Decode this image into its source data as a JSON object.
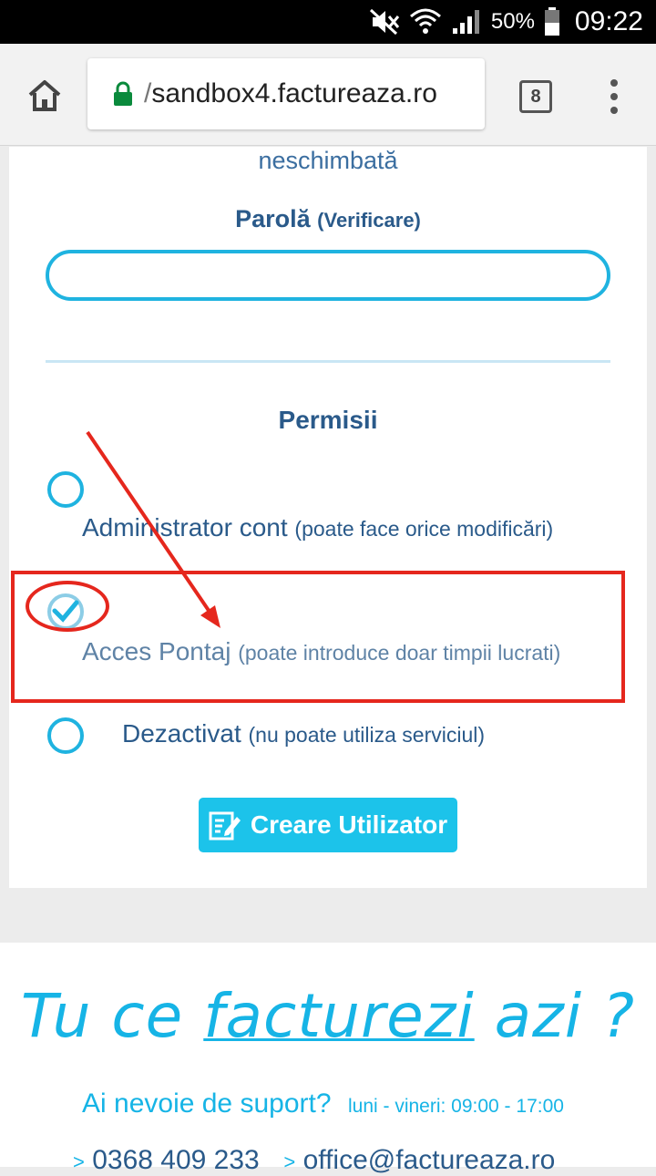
{
  "status_bar": {
    "battery_percent": "50%",
    "time": "09:22",
    "icons": [
      "mute-icon",
      "wifi-icon",
      "signal-icon",
      "battery-icon"
    ]
  },
  "browser": {
    "url_slash": "/",
    "url": "sandbox4.factureaza.ro",
    "tab_count": "8",
    "icons": [
      "home-icon",
      "lock-icon",
      "tabs-icon",
      "overflow-menu-icon"
    ]
  },
  "form": {
    "note_tail": "neschimbată",
    "password_label": "Parolă",
    "password_label_sub": "(Verificare)",
    "password_value": "",
    "permissions_title": "Permisii",
    "options": [
      {
        "label": "Administrator cont",
        "sub": "(poate face orice modificări)",
        "selected": false
      },
      {
        "label": "Acces Pontaj",
        "sub": "(poate introduce doar timpii lucrati)",
        "selected": true
      },
      {
        "label": "Dezactivat",
        "sub": "(nu poate utiliza serviciul)",
        "selected": false
      }
    ],
    "create_button": "Creare Utilizator"
  },
  "annotation": {
    "color": "#e5271d"
  },
  "footer": {
    "slogan_before": "Tu ce ",
    "slogan_brand": "facturezi",
    "slogan_after": " azi ?",
    "support_question": "Ai nevoie de suport?",
    "support_hours": "luni - vineri: 09:00 - 17:00",
    "phone_arrow": ">",
    "phone": "0368 409 233",
    "email_arrow": ">",
    "email": "office@factureaza.ro"
  },
  "colors": {
    "accent": "#1cc3ea",
    "text": "#2a5a8a",
    "highlight": "#e5271d"
  }
}
